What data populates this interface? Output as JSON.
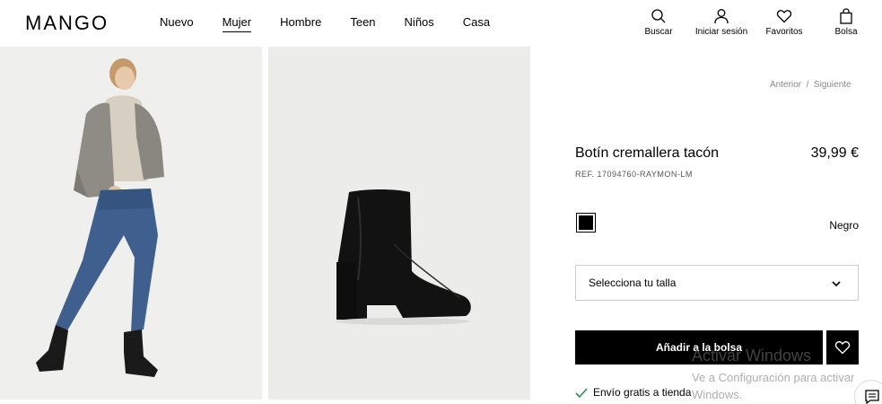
{
  "header": {
    "logo": "MANGO",
    "nav": [
      "Nuevo",
      "Mujer",
      "Hombre",
      "Teen",
      "Niños",
      "Casa"
    ],
    "active_nav": "Mujer",
    "utils": {
      "search": "Buscar",
      "login": "Iniciar sesión",
      "favorites": "Favoritos",
      "bag": "Bolsa"
    }
  },
  "breadcrumb": {
    "prev": "Anterior",
    "sep": "/",
    "next": "Siguiente"
  },
  "product": {
    "name": "Botín cremallera tacón",
    "price": "39,99 €",
    "ref": "REF. 17094760-RAYMON-LM",
    "color_name": "Negro",
    "color_hex": "#000000",
    "size_placeholder": "Selecciona tu talla",
    "add_to_bag": "Añadir a la bolsa",
    "shipping": "Envío gratis a tienda"
  },
  "watermark": {
    "title": "Activar Windows",
    "subtitle": "Ve a Configuración para activar Windows."
  },
  "icons": {
    "search": "search-icon",
    "user": "user-icon",
    "heart": "heart-icon",
    "bag": "bag-icon",
    "chevron": "chevron-down-icon",
    "check": "check-icon",
    "chat": "chat-icon"
  }
}
